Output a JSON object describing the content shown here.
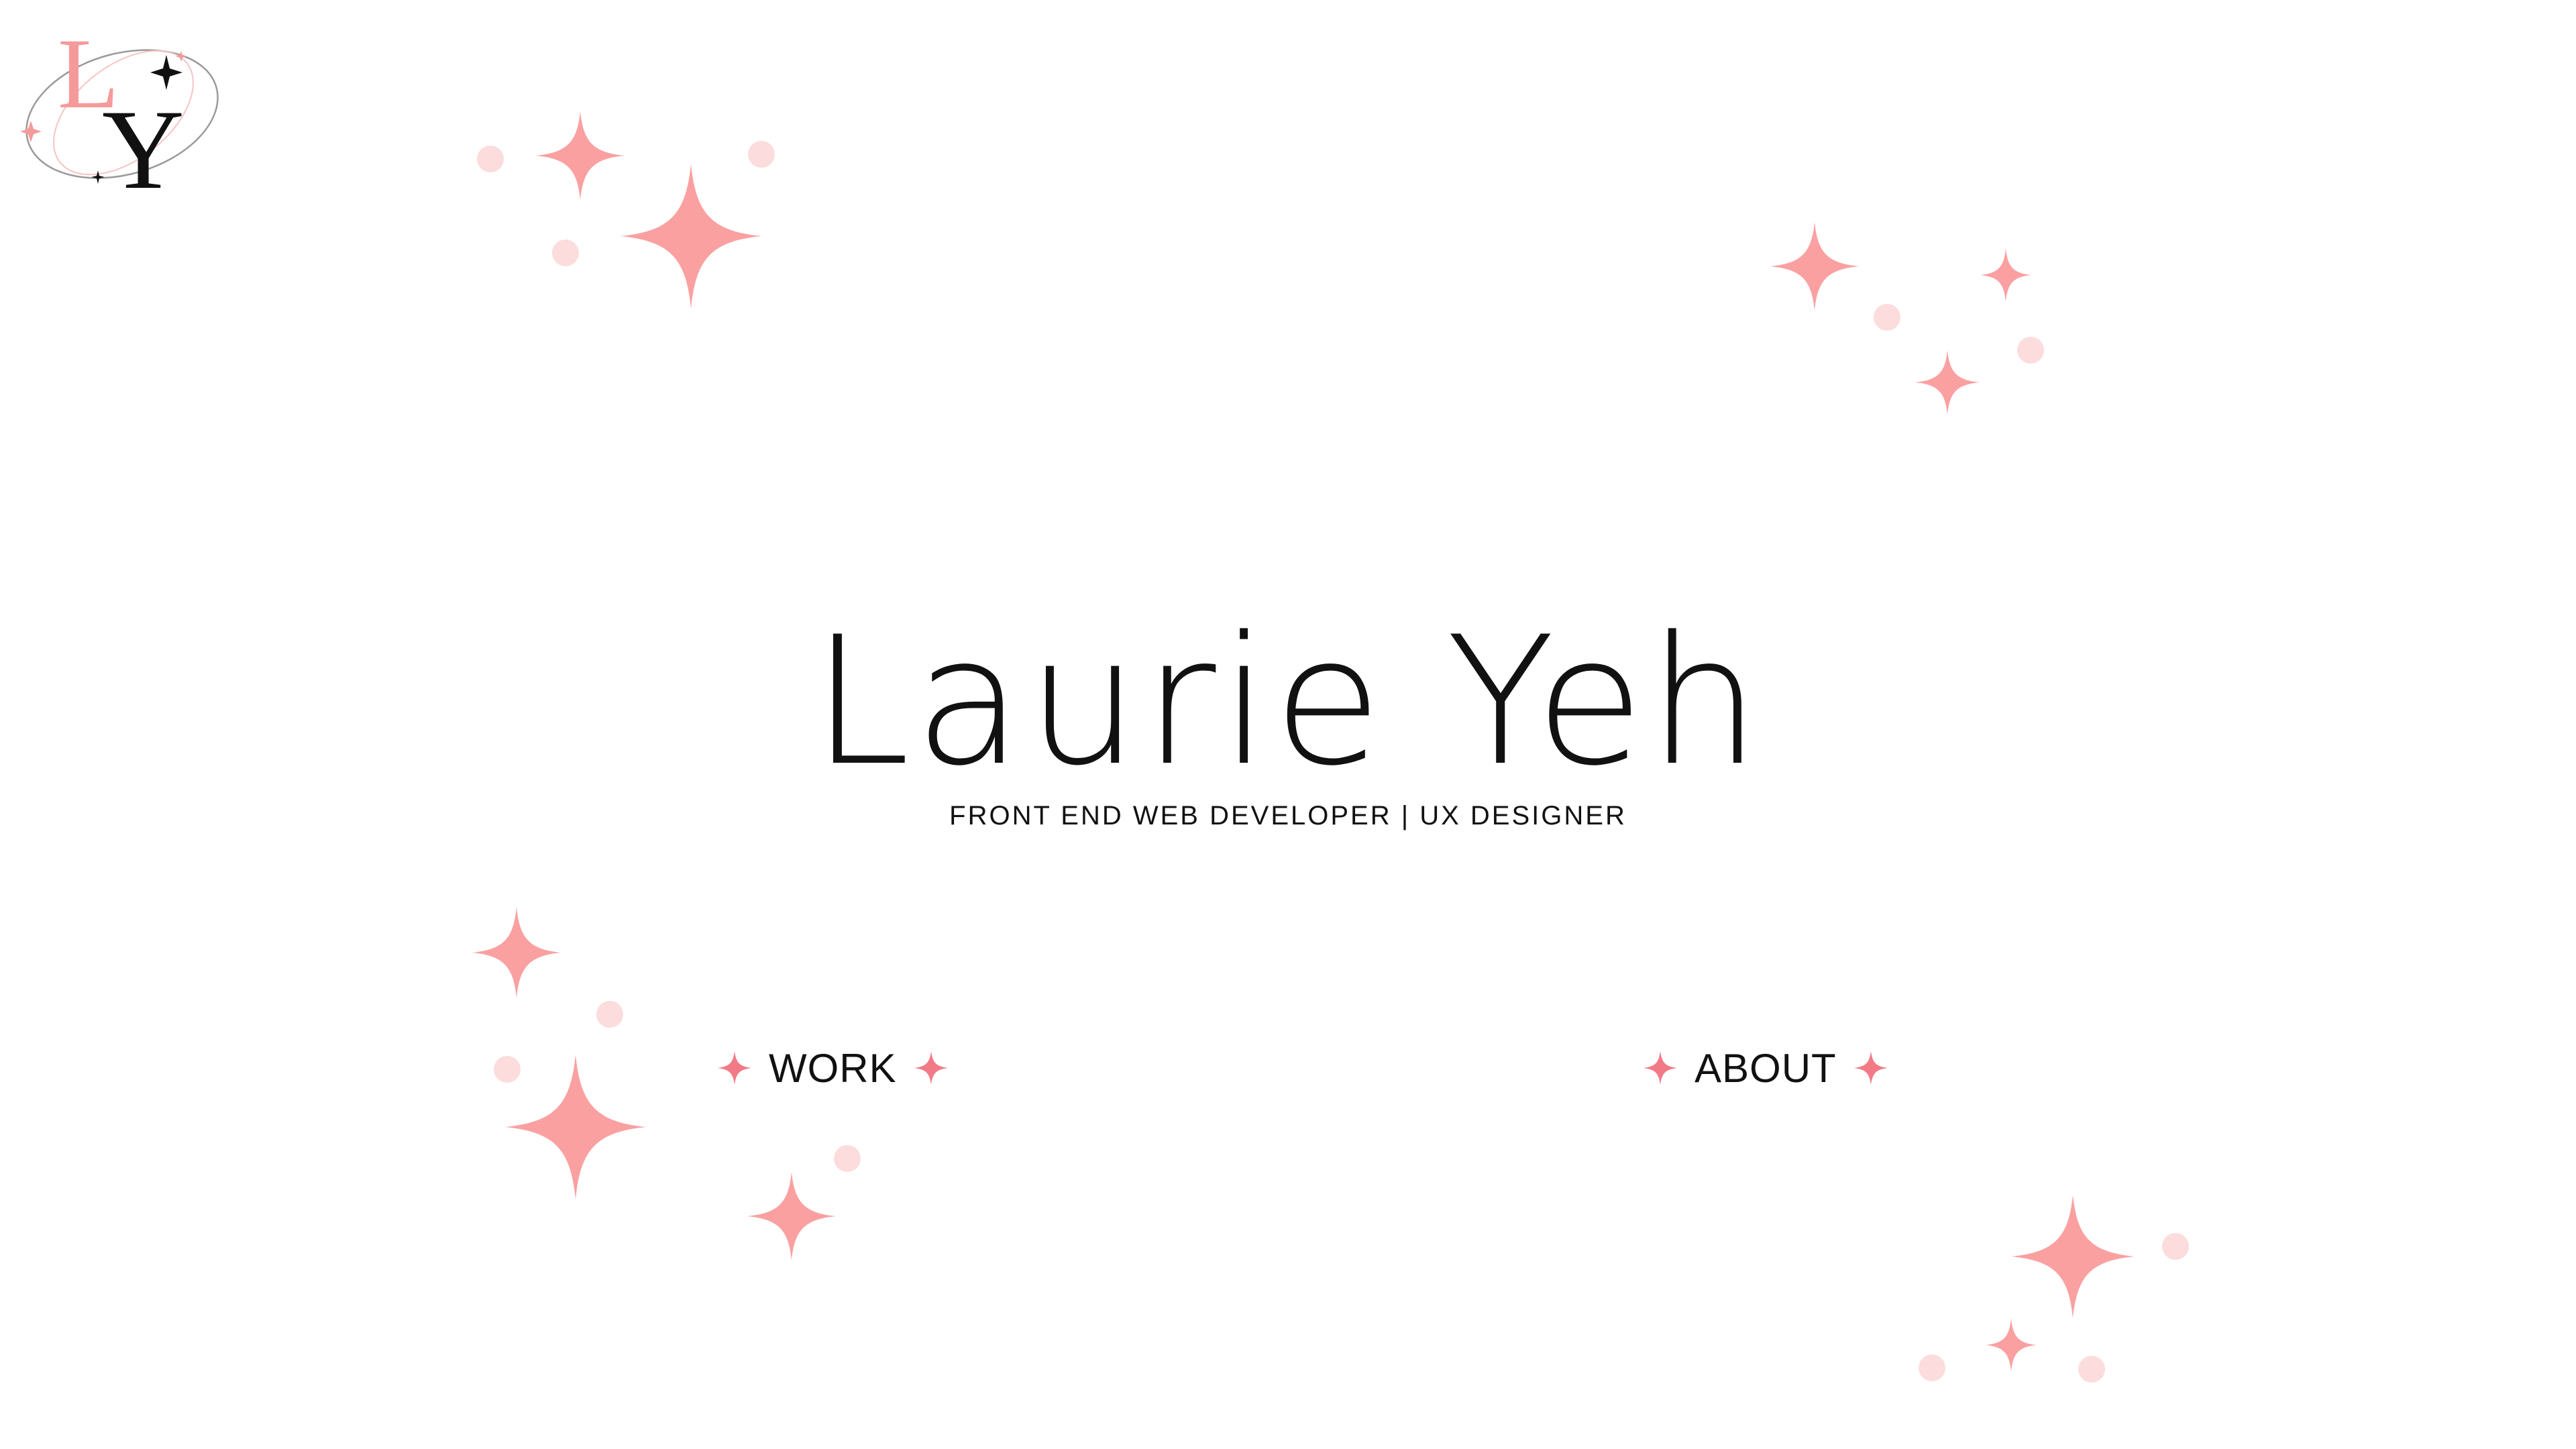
{
  "logo": {
    "letters": "LY",
    "colors": {
      "pink": "#f59a9a",
      "black": "#111111"
    }
  },
  "hero": {
    "name": "Laurie Yeh",
    "tagline": "FRONT END WEB DEVELOPER | UX DESIGNER"
  },
  "nav": {
    "work_label": "WORK",
    "about_label": "ABOUT",
    "bullet_icon": "sparkle-icon"
  },
  "colors": {
    "sparkle": "#fba0a1",
    "dot": "#fcdcdc",
    "nav_sparkle": "#f27a87",
    "text": "#111111",
    "background": "#ffffff"
  }
}
